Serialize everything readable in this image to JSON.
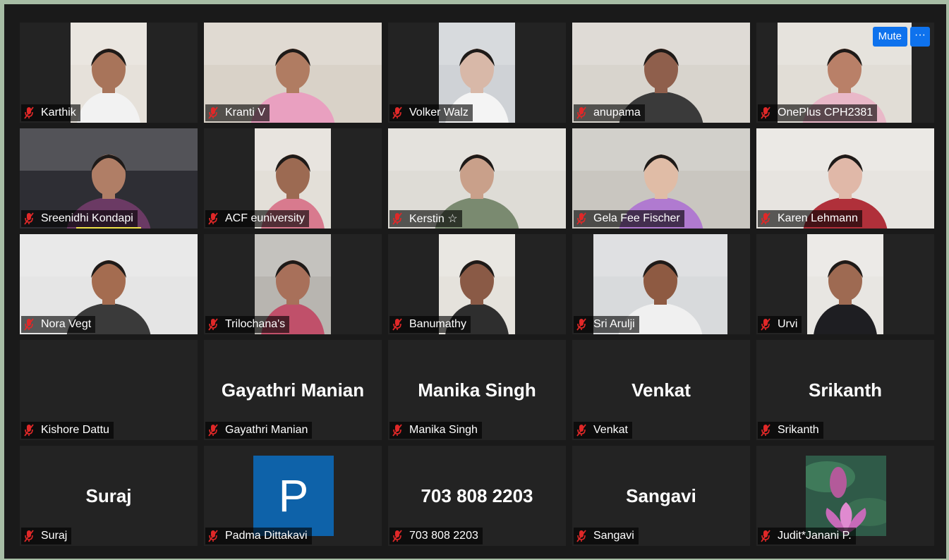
{
  "controls": {
    "mute_label": "Mute",
    "more_label": "···"
  },
  "participants": [
    {
      "name": "Karthik",
      "kind": "video",
      "skin": "#a8745a",
      "bg": "#e6e1da",
      "shirt": "#f2f2f2"
    },
    {
      "name": "Kranti V",
      "kind": "video",
      "skin": "#b07c62",
      "bg": "#d9d2c8",
      "shirt": "#e9a0c0"
    },
    {
      "name": "Volker Walz",
      "kind": "video",
      "skin": "#d8b8a8",
      "bg": "#cfd2d6",
      "shirt": "#f4f4f4"
    },
    {
      "name": "anupama",
      "kind": "video",
      "skin": "#8f5f4c",
      "bg": "#d8d4cd",
      "shirt": "#3a3a3a"
    },
    {
      "name": "OnePlus CPH2381",
      "kind": "video",
      "skin": "#b98068",
      "bg": "#e1ddd6",
      "shirt": "#e9b8c8"
    },
    {
      "name": "Sreenidhi Kondapi",
      "kind": "video",
      "skin": "#b07e66",
      "bg": "#2e2e34",
      "shirt": "#6b3a64"
    },
    {
      "name": "ACF euniversity",
      "kind": "video",
      "skin": "#9c6a52",
      "bg": "#e3dfd8",
      "shirt": "#d87a8e"
    },
    {
      "name": "Kerstin ☆",
      "kind": "video",
      "skin": "#c9a08a",
      "bg": "#dedcd6",
      "shirt": "#7a8a70"
    },
    {
      "name": "Gela Fee Fischer",
      "kind": "video",
      "skin": "#e0bca6",
      "bg": "#c9c6c0",
      "shirt": "#b07ad0"
    },
    {
      "name": "Karen Lehmann",
      "kind": "video",
      "skin": "#e0b8a8",
      "bg": "#e7e4e0",
      "shirt": "#b0303a"
    },
    {
      "name": "Nora Vegt",
      "kind": "video",
      "skin": "#a46c50",
      "bg": "#e5e5e5",
      "shirt": "#3a3a3a"
    },
    {
      "name": "Trilochana's",
      "kind": "video",
      "skin": "#a8705a",
      "bg": "#b8b5b0",
      "shirt": "#c0506a"
    },
    {
      "name": "Banumathy",
      "kind": "video",
      "skin": "#8a5a46",
      "bg": "#e5e2dc",
      "shirt": "#2e2e2e"
    },
    {
      "name": "Sri Arulji",
      "kind": "video",
      "skin": "#8e5a42",
      "bg": "#d8dadc",
      "shirt": "#f0f0f0"
    },
    {
      "name": "Urvi",
      "kind": "video",
      "skin": "#9e6a52",
      "bg": "#e8e6e2",
      "shirt": "#1e1e22"
    },
    {
      "name": "Kishore Dattu",
      "kind": "blank"
    },
    {
      "name": "Gayathri Manian",
      "kind": "name",
      "big": "Gayathri Manian"
    },
    {
      "name": "Manika Singh",
      "kind": "name",
      "big": "Manika Singh"
    },
    {
      "name": "Venkat",
      "kind": "name",
      "big": "Venkat"
    },
    {
      "name": "Srikanth",
      "kind": "name",
      "big": "Srikanth"
    },
    {
      "name": "Suraj",
      "kind": "name",
      "big": "Suraj"
    },
    {
      "name": "Padma Dittakavi",
      "kind": "avatar",
      "avatar_letter": "P"
    },
    {
      "name": "703 808 2203",
      "kind": "name",
      "big": "703 808 2203"
    },
    {
      "name": "Sangavi",
      "kind": "name",
      "big": "Sangavi"
    },
    {
      "name": "Judit*Janani P.",
      "kind": "lotus"
    }
  ],
  "colors": {
    "tile_bg": "#232323",
    "grid_bg": "#1a1a1a",
    "accent": "#0e72ed",
    "muted_mic": "#e02828",
    "avatar_blue": "#0e62a9"
  },
  "icons": {
    "muted_mic": "mic-muted-icon",
    "more": "ellipsis-icon"
  }
}
